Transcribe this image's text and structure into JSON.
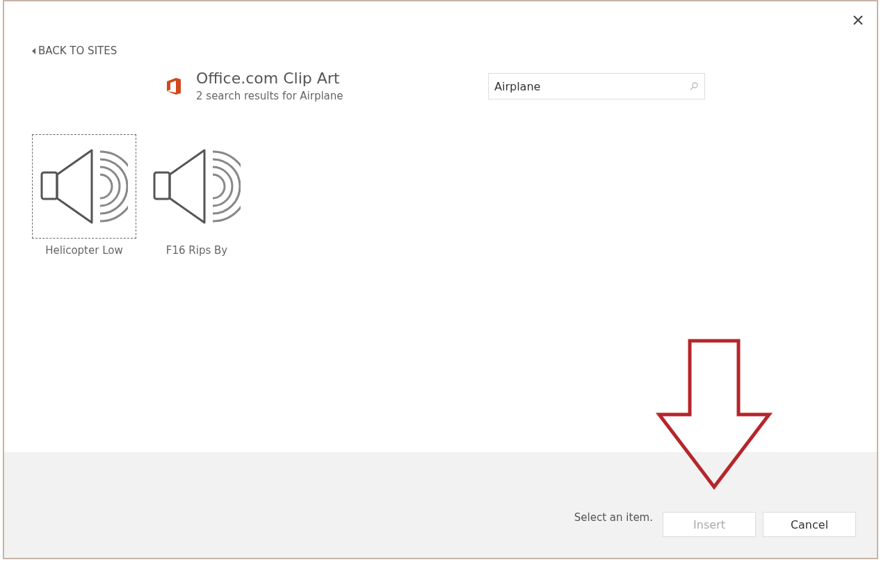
{
  "back_link": {
    "label": "BACK TO SITES"
  },
  "source": {
    "title": "Office.com Clip Art",
    "subtitle": "2 search results for Airplane"
  },
  "search": {
    "value": "Airplane"
  },
  "results": [
    {
      "label": "Helicopter Low",
      "selected": true
    },
    {
      "label": "F16 Rips By",
      "selected": false
    }
  ],
  "footer": {
    "status": "Select an item.",
    "buttons": [
      {
        "label": "Insert",
        "disabled": true
      },
      {
        "label": "Cancel",
        "disabled": false
      }
    ]
  }
}
